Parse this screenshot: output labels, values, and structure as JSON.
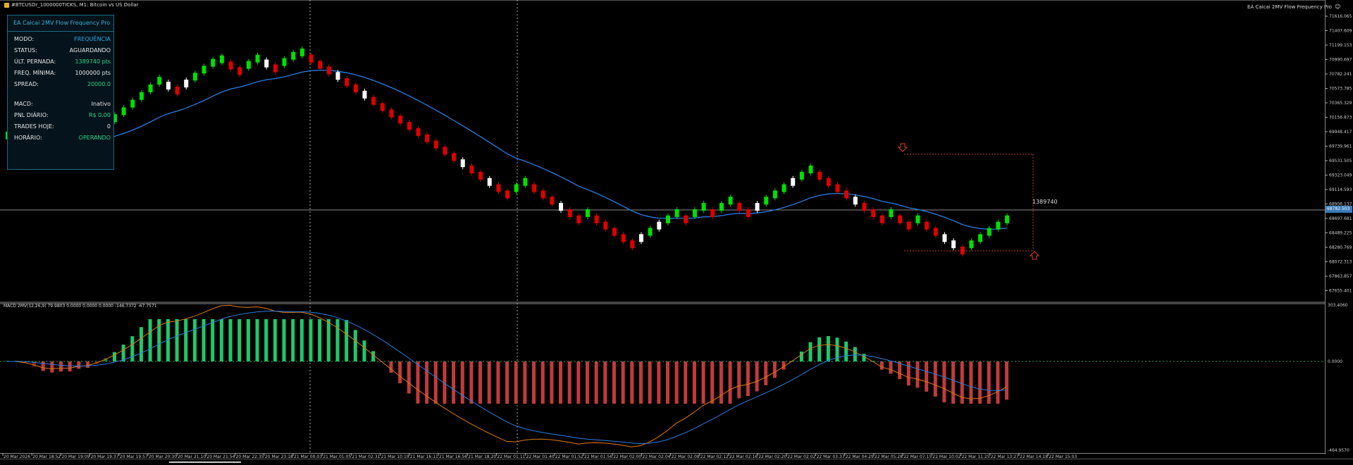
{
  "window": {
    "title": "#BTCUSDr_1000000TICKS, M1:  Bitcoin vs US Dollar",
    "ea_name": "EA Caicai 2MV Flow Frequency Pro",
    "ea_icon": "smiley-icon"
  },
  "panel": {
    "title": "EA Caicai 2MV Flow Frequency Pro",
    "rows": [
      {
        "label": "MODO:",
        "value": "FREQUÊNCIA",
        "color": "#2fa3e0"
      },
      {
        "label": "STATUS:",
        "value": "AGUARDANDO",
        "color": "#e6e6e6"
      },
      {
        "label": "ÚLT. PERNADA:",
        "value": "1389740 pts",
        "color": "#27d58a"
      },
      {
        "label": "FREQ. MÍNIMA:",
        "value": "1000000 pts",
        "color": "#e6e6e6"
      },
      {
        "label": "SPREAD:",
        "value": "20000.0",
        "color": "#27d58a"
      },
      {
        "label": "MACD:",
        "value": "Inativo",
        "color": "#e6e6e6"
      },
      {
        "label": "PNL DIÁRIO:",
        "value": "R$ 0.00",
        "color": "#27d58a"
      },
      {
        "label": "TRADES HOJE:",
        "value": "0",
        "color": "#e6e6e6"
      },
      {
        "label": "HORÁRIO:",
        "value": "OPERANDO",
        "color": "#27d58a"
      }
    ]
  },
  "price_scale": [
    "71616.065",
    "71407.609",
    "71199.153",
    "70990.697",
    "70782.241",
    "70573.785",
    "70365.329",
    "70156.873",
    "69948.417",
    "69739.961",
    "69531.505",
    "69323.049",
    "69114.593",
    "68906.137",
    "68697.681",
    "68489.225",
    "68280.769",
    "68072.313",
    "67863.857",
    "67655.401"
  ],
  "current_price": "68782.503",
  "leg_label": "1389740",
  "macd": {
    "label": "MACD 2MV(12,26,9) 79.9803 0.0000 0.0000 0.0000 -146.7372 -67.7571",
    "scale_top": "303.4060",
    "scale_zero": "0.0000",
    "scale_bottom": "-464.9570"
  },
  "time_labels": [
    "20 Mar 2026",
    "20 Mar 18:52",
    "20 Mar 19:09",
    "20 Mar 19:37",
    "20 Mar 19:57",
    "20 Mar 20:30",
    "20 Mar 21:10",
    "20 Mar 21:54",
    "20 Mar 22:35",
    "20 Mar 23:18",
    "21 Mar 00:03",
    "21 Mar 01:05",
    "21 Mar 02:31",
    "21 Mar 10:19",
    "21 Mar 16:11",
    "21 Mar 16:56",
    "21 Mar 18:20",
    "22 Mar 01:11",
    "22 Mar 01:40",
    "22 Mar 01:52",
    "22 Mar 01:56",
    "22 Mar 02:00",
    "22 Mar 02:04",
    "22 Mar 02:08",
    "22 Mar 02:12",
    "22 Mar 02:16",
    "22 Mar 02:20",
    "22 Mar 02:02",
    "22 Mar 03:37",
    "22 Mar 04:29",
    "22 Mar 05:28",
    "22 Mar 07:15",
    "22 Mar 10:02",
    "22 Mar 11:25",
    "22 Mar 13:27",
    "22 Mar 14:18",
    "22 Mar 15:03"
  ],
  "chart_data": {
    "type": "candlestick",
    "bricks_close": [
      69950,
      69950,
      69880,
      69800,
      69730,
      69800,
      69880,
      69850,
      69950,
      69900,
      70030,
      70110,
      70200,
      70300,
      70410,
      70520,
      70630,
      70740,
      70670,
      70600,
      70700,
      70800,
      70900,
      71000,
      71050,
      70960,
      70880,
      70970,
      71060,
      70990,
      70920,
      71010,
      71100,
      71150,
      71060,
      70970,
      70890,
      70810,
      70720,
      70630,
      70540,
      70450,
      70360,
      70270,
      70180,
      70090,
      70000,
      69910,
      69820,
      69730,
      69640,
      69550,
      69460,
      69370,
      69280,
      69190,
      69100,
      69190,
      69280,
      69190,
      69100,
      69010,
      68920,
      68830,
      68740,
      68830,
      68740,
      68650,
      68560,
      68470,
      68380,
      68470,
      68560,
      68650,
      68740,
      68830,
      68740,
      68830,
      68920,
      68830,
      68920,
      69010,
      68920,
      68830,
      68920,
      69010,
      69100,
      69190,
      69280,
      69370,
      69460,
      69370,
      69280,
      69190,
      69100,
      69010,
      68920,
      68830,
      68740,
      68830,
      68740,
      68650,
      68740,
      68650,
      68560,
      68470,
      68380,
      68290,
      68380,
      68470,
      68560,
      68650,
      68740
    ]
  }
}
